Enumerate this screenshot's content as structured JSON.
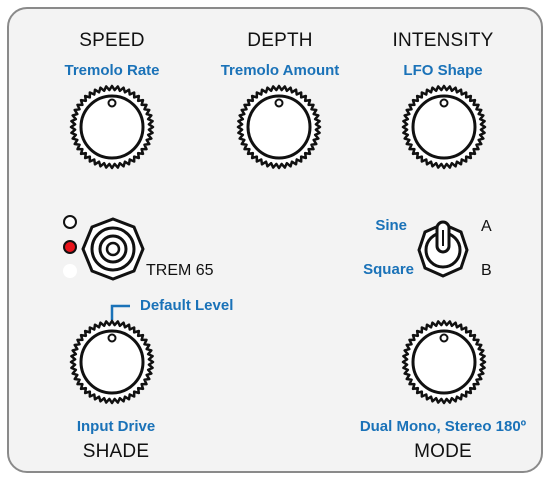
{
  "knobs": {
    "speed": {
      "title": "SPEED",
      "subtitle": "Tremolo Rate"
    },
    "depth": {
      "title": "DEPTH",
      "subtitle": "Tremolo Amount"
    },
    "intensity": {
      "title": "INTENSITY",
      "subtitle": "LFO Shape"
    },
    "shade": {
      "title": "SHADE",
      "subtitle": "Input Drive",
      "annotation": "Default Level"
    },
    "mode": {
      "title": "MODE",
      "subtitle": "Dual Mono, Stereo 180º"
    }
  },
  "footswitch": {
    "label": "TREM 65"
  },
  "leds": [
    {
      "state": "off",
      "color": "#ffffff"
    },
    {
      "state": "off",
      "color": "#ffffff"
    },
    {
      "state": "on",
      "color": "#e8141b"
    }
  ],
  "toggle": {
    "left_top": "Sine",
    "left_bottom": "Square",
    "right_top": "A",
    "right_bottom": "B"
  },
  "colors": {
    "accent": "#1a72b8",
    "led_on": "#e8141b",
    "panel": "#f3f3f3"
  }
}
